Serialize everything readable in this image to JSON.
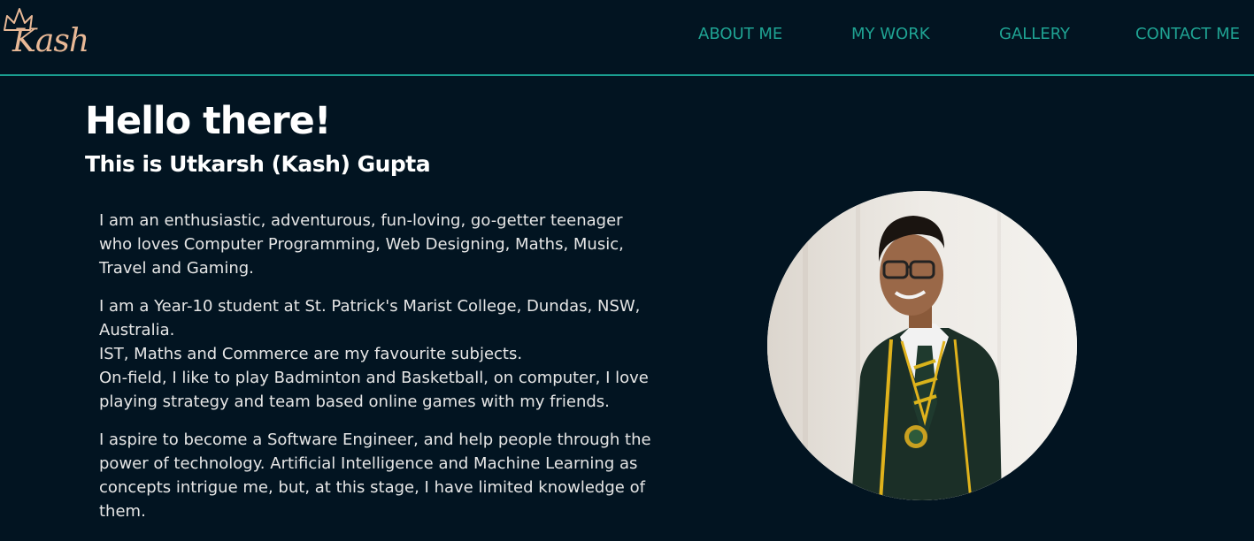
{
  "header": {
    "logo_text": "Kash",
    "nav": [
      {
        "label": "ABOUT ME"
      },
      {
        "label": "MY WORK"
      },
      {
        "label": "GALLERY"
      },
      {
        "label": "CONTACT ME"
      }
    ]
  },
  "main": {
    "title": "Hello there!",
    "subtitle": "This is Utkarsh (Kash) Gupta",
    "paragraphs": [
      {
        "lines": [
          "I am an enthusiastic, adventurous, fun-loving, go-getter teenager",
          "who loves Computer Programming, Web Designing, Maths, Music,",
          "Travel and Gaming."
        ]
      },
      {
        "lines": [
          "I am a Year-10 student at St. Patrick's Marist College, Dundas, NSW,",
          "Australia.",
          "IST, Maths and Commerce are my favourite subjects.",
          "On-field, I like to play Badminton and Basketball, on computer, I love",
          "playing strategy and team based online games with my friends."
        ]
      },
      {
        "lines": [
          "I aspire to become a Software Engineer, and help people through the",
          "power of technology. Artificial Intelligence and Machine Learning as",
          "concepts intrigue me, but, at this stage, I have limited knowledge of",
          "them."
        ]
      }
    ]
  },
  "colors": {
    "background": "#021421",
    "accent": "#1fa393",
    "logo": "#e8b896",
    "heading": "#ffffff",
    "body_text": "#e6e6e6"
  }
}
